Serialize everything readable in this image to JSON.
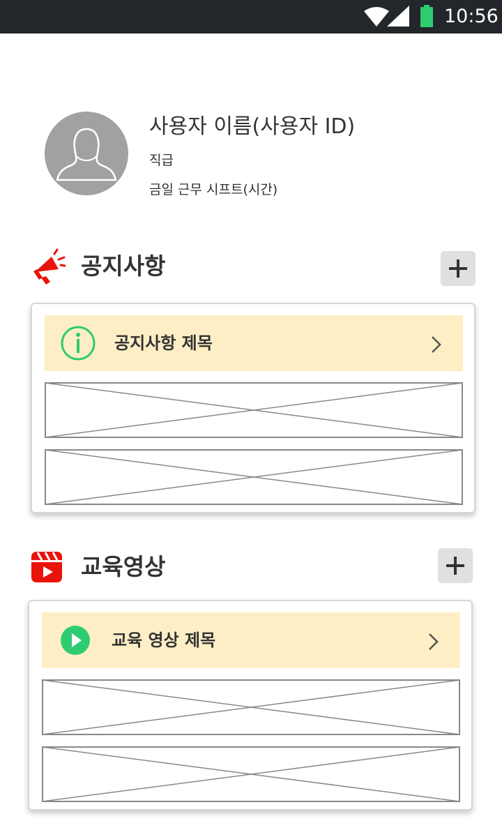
{
  "status_bar": {
    "time": "10:56",
    "icons": [
      "wifi-icon",
      "cell-signal-icon",
      "battery-icon"
    ],
    "battery_color": "#2ecc71"
  },
  "profile": {
    "name": "사용자 이름(사용자 ID)",
    "position": "직급",
    "shift": "금일 근무 시프트(시간)",
    "avatar_icon": "person-silhouette-icon"
  },
  "notice": {
    "title": "공지사항",
    "icon": "megaphone-icon",
    "add_icon": "plus-icon",
    "featured": {
      "title": "공지사항 제목",
      "icon": "info-circle-icon"
    },
    "placeholder_count": 2
  },
  "video": {
    "title": "교육영상",
    "icon": "video-clapper-icon",
    "add_icon": "plus-icon",
    "featured": {
      "title": "교육 영상 제목",
      "icon": "play-circle-icon"
    },
    "placeholder_count": 2
  },
  "colors": {
    "status_bar_bg": "#23272b",
    "highlight_bg": "#feeec6",
    "accent_red": "#e8140c",
    "accent_green": "#2ecc71",
    "avatar_bg": "#a1a1a1",
    "add_button_bg": "#e0e0e0"
  }
}
